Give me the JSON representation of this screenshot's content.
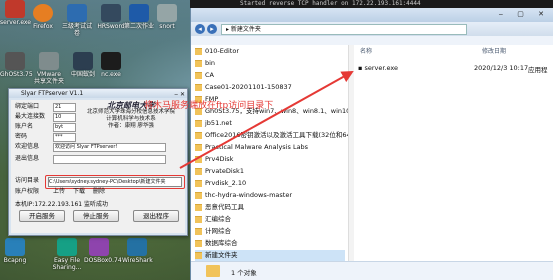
{
  "topbar": {
    "text": "Started reverse TCP handler on 172.22.193.161:4444"
  },
  "desktop": {
    "icons": [
      {
        "label": "server.exe"
      },
      {
        "label": "Firefox"
      },
      {
        "label": "三级考试试卷"
      },
      {
        "label": "HRSword"
      },
      {
        "label": "第二次作业"
      },
      {
        "label": "snort"
      },
      {
        "label": "GhOSt3.75"
      },
      {
        "label": "VMware 共享文件夹"
      },
      {
        "label": "中国蚁剑"
      },
      {
        "label": "nc.exe"
      },
      {
        "label": "Bcapng"
      },
      {
        "label": "Easy File Sharing..."
      },
      {
        "label": "DOSBox0.74"
      },
      {
        "label": "WireShark"
      }
    ]
  },
  "ftp": {
    "title": "Slyar FTPserver V1.1",
    "fields": [
      {
        "label": "绑定端口",
        "value": "21"
      },
      {
        "label": "最大连接数",
        "value": "10"
      },
      {
        "label": "账户名",
        "value": "byt"
      },
      {
        "label": "密码",
        "value": "***"
      },
      {
        "label": "欢迎信息",
        "value": ""
      },
      {
        "label": "退出信息",
        "value": ""
      }
    ],
    "welcome_value": "欢迎访问 Slyar FTPserver!",
    "logo_brand": "北京邮电大学",
    "logo_lines": [
      "北京师范大学珠海分校信息技术学院",
      "计算机科学与技术系",
      "作者：康翔  廖华强"
    ],
    "dir_label": "访问目录",
    "dir_value": "C:\\Users\\sydney.sydney-PC\\Desktop\\新建文件夹",
    "perm_title": "账户权限",
    "perms": [
      "上传",
      "下载",
      "删除"
    ],
    "status": "本机IP:172.22.193.161  监听成功",
    "buttons": {
      "start": "开启服务",
      "stop": "停止服务",
      "exit": "退出程序"
    }
  },
  "explorer": {
    "breadcrumb": "▸ 新建文件夹",
    "sidebar": [
      "010-Editor",
      "bin",
      "CA",
      "Case01-20201101-150837",
      "FMP",
      "Gh0St3.75，支持win7、win8、win8.1、win10系统",
      "jb51.net",
      "Office2016密钥激活以及激活工具下载(32位和64位",
      "Practical Malware Analysis Labs",
      "Prv4Disk",
      "PrvateDisk1",
      "Prvdisk_2.10",
      "thc-hydra-windows-master",
      "恶意代码工具",
      "汇编综合",
      "计网综合",
      "数据库综合",
      "新建文件夹"
    ],
    "columns": {
      "name": "名称",
      "date": "修改日期"
    },
    "file": {
      "name": "server.exe",
      "date": "2020/12/3 10:17",
      "type": "应用程"
    },
    "note": "将木马服务端放在ftp访问目录下",
    "status": "1 个对象"
  }
}
